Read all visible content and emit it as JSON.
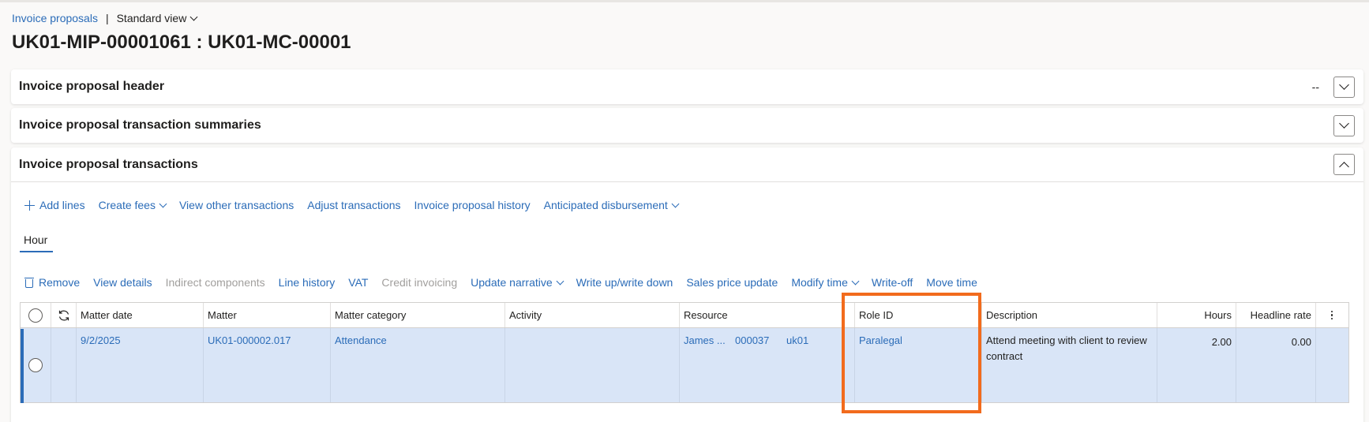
{
  "breadcrumb": {
    "link": "Invoice proposals",
    "separator": "|",
    "view": "Standard view"
  },
  "title": "UK01-MIP-00001061 : UK01-MC-00001",
  "sections": {
    "header": {
      "title": "Invoice proposal header",
      "summary": "--"
    },
    "summaries": {
      "title": "Invoice proposal transaction summaries"
    },
    "transactions": {
      "title": "Invoice proposal transactions"
    }
  },
  "toolbar1": {
    "add_lines": "Add lines",
    "create_fees": "Create fees",
    "view_other": "View other transactions",
    "adjust": "Adjust transactions",
    "history": "Invoice proposal history",
    "anticipated": "Anticipated disbursement"
  },
  "tab": "Hour",
  "toolbar2": {
    "remove": "Remove",
    "view_details": "View details",
    "indirect": "Indirect components",
    "line_history": "Line history",
    "vat": "VAT",
    "credit": "Credit invoicing",
    "update_narrative": "Update narrative",
    "write_up": "Write up/write down",
    "sales_price": "Sales price update",
    "modify_time": "Modify time",
    "write_off": "Write-off",
    "move_time": "Move time"
  },
  "grid": {
    "columns": {
      "matter_date": "Matter date",
      "matter": "Matter",
      "matter_category": "Matter category",
      "activity": "Activity",
      "resource": "Resource",
      "role_id": "Role ID",
      "description": "Description",
      "hours": "Hours",
      "headline_rate": "Headline rate"
    },
    "rows": [
      {
        "matter_date": "9/2/2025",
        "matter": "UK01-000002.017",
        "matter_category": "Attendance",
        "activity": "",
        "resource_name": "James ...",
        "resource_id": "000037",
        "resource_company": "uk01",
        "role_id": "Paralegal",
        "description": "Attend meeting with client to review contract",
        "hours": "2.00",
        "headline_rate": "0.00"
      }
    ]
  },
  "colors": {
    "link": "#2b6cb8",
    "selected_row": "#d9e5f7",
    "highlight": "#f26b1d"
  }
}
